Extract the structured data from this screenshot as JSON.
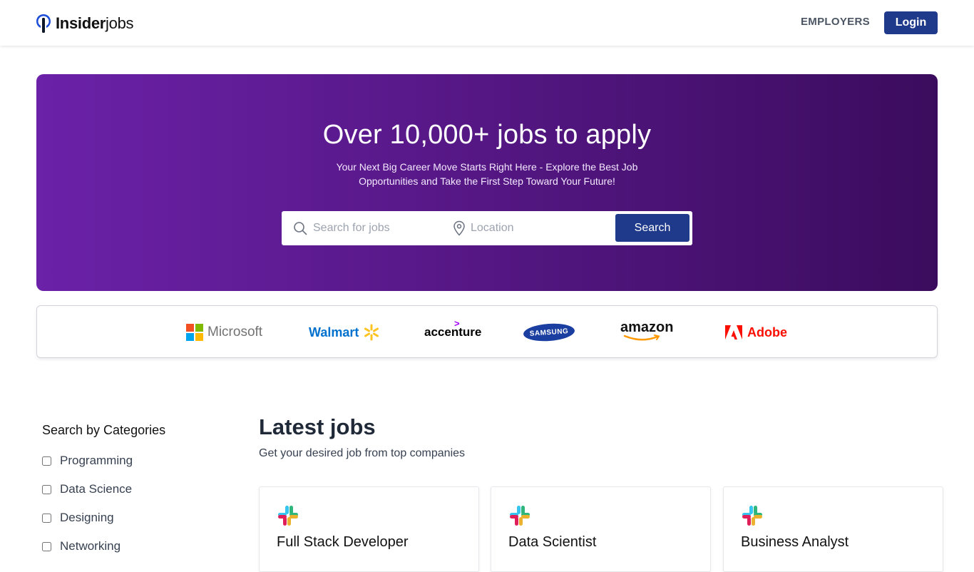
{
  "navbar": {
    "logo_bold": "Insider",
    "logo_light": "jobs",
    "employers_label": "EMPLOYERS",
    "login_label": "Login"
  },
  "hero": {
    "title": "Over 10,000+ jobs to apply",
    "subtitle": "Your Next Big Career Move Starts Right Here - Explore the Best Job Opportunities and Take the First Step Toward Your Future!",
    "search_placeholder": "Search for jobs",
    "location_placeholder": "Location",
    "search_button": "Search"
  },
  "companies": [
    {
      "name": "Microsoft"
    },
    {
      "name": "Walmart"
    },
    {
      "name": "accenture"
    },
    {
      "name": "SAMSUNG"
    },
    {
      "name": "amazon"
    },
    {
      "name": "Adobe"
    }
  ],
  "sidebar": {
    "title": "Search by Categories",
    "categories": [
      {
        "label": "Programming",
        "checked": false
      },
      {
        "label": "Data Science",
        "checked": false
      },
      {
        "label": "Designing",
        "checked": false
      },
      {
        "label": "Networking",
        "checked": false
      }
    ]
  },
  "latest": {
    "title": "Latest jobs",
    "subtitle": "Get your desired job from top companies",
    "jobs": [
      {
        "title": "Full Stack Developer",
        "company_icon": "slack-icon"
      },
      {
        "title": "Data Scientist",
        "company_icon": "slack-icon"
      },
      {
        "title": "Business Analyst",
        "company_icon": "slack-icon"
      }
    ]
  },
  "colors": {
    "brand_blue": "#1f3a8a",
    "hero_start": "#6b21a8",
    "hero_end": "#3b0c5e"
  }
}
